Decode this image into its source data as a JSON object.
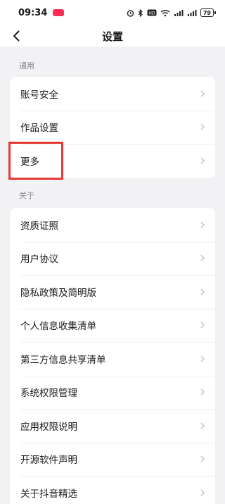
{
  "status_bar": {
    "time": "09:34",
    "battery": "79",
    "icons": [
      "app-notification-icon",
      "alarm-icon",
      "bluetooth-icon",
      "hd-icon",
      "wifi-icon",
      "signal-icon",
      "signal-icon",
      "battery-icon"
    ]
  },
  "header": {
    "title": "设置",
    "back_icon": "back-arrow-icon"
  },
  "sections": [
    {
      "label": "通用",
      "items": [
        {
          "label": "账号安全"
        },
        {
          "label": "作品设置"
        },
        {
          "label": "更多"
        }
      ]
    },
    {
      "label": "关于",
      "items": [
        {
          "label": "资质证照"
        },
        {
          "label": "用户协议"
        },
        {
          "label": "隐私政策及简明版"
        },
        {
          "label": "个人信息收集清单"
        },
        {
          "label": "第三方信息共享清单"
        },
        {
          "label": "系统权限管理"
        },
        {
          "label": "应用权限说明"
        },
        {
          "label": "开源软件声明"
        },
        {
          "label": "关于抖音精选"
        }
      ]
    }
  ],
  "annotation": {
    "highlight_color": "#e53935",
    "highlighted_item": "更多"
  },
  "colors": {
    "background": "#f2f2f4",
    "card": "#ffffff",
    "section_label": "#8a8a8f",
    "chevron": "#c4c4c7"
  }
}
